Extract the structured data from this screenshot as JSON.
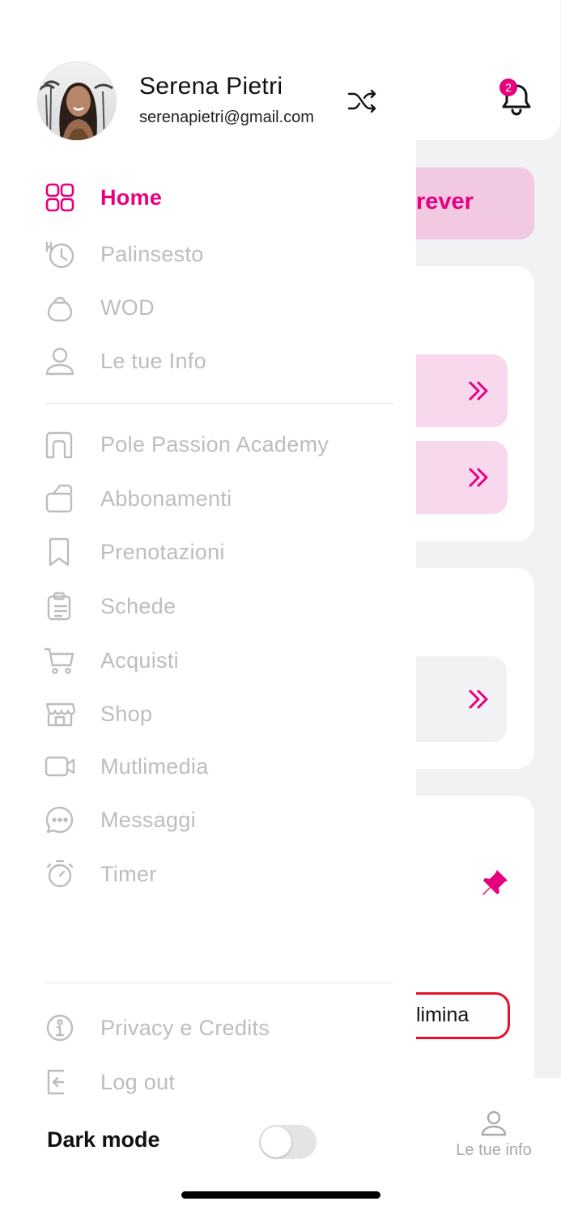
{
  "colors": {
    "accent": "#e6007e",
    "menu_inactive": "#bdbdbd",
    "danger_border": "#e8102a",
    "pill_bg": "#f8d8ec"
  },
  "background": {
    "notification_count": "2",
    "banner_partial_text": "rever",
    "delete_button_partial_text": "limina",
    "bottom_tab_label": "Le tue info",
    "icons": [
      "bell-icon",
      "double-chevron-right-icon",
      "pin-icon",
      "user-icon"
    ]
  },
  "user": {
    "name": "Serena Pietri",
    "email": "serenapietri@gmail.com"
  },
  "menu_primary": [
    {
      "label": "Home",
      "icon": "grid-icon",
      "active": true
    },
    {
      "label": "Palinsesto",
      "icon": "history-icon"
    },
    {
      "label": "WOD",
      "icon": "kettlebell-icon"
    },
    {
      "label": "Le tue Info",
      "icon": "user-icon"
    }
  ],
  "menu_secondary": [
    {
      "label": "Pole Passion Academy",
      "icon": "gym-icon"
    },
    {
      "label": "Abbonamenti",
      "icon": "card-icon"
    },
    {
      "label": "Prenotazioni",
      "icon": "bookmark-icon"
    },
    {
      "label": "Schede",
      "icon": "clipboard-icon"
    },
    {
      "label": "Acquisti",
      "icon": "cart-icon"
    },
    {
      "label": "Shop",
      "icon": "store-icon"
    },
    {
      "label": "Mutlimedia",
      "icon": "video-icon"
    },
    {
      "label": "Messaggi",
      "icon": "chat-icon"
    },
    {
      "label": "Timer",
      "icon": "stopwatch-icon"
    }
  ],
  "menu_footer": [
    {
      "label": "Privacy e Credits",
      "icon": "info-icon"
    },
    {
      "label": "Log out",
      "icon": "logout-icon"
    }
  ],
  "dark_mode": {
    "label": "Dark mode",
    "enabled": false
  }
}
